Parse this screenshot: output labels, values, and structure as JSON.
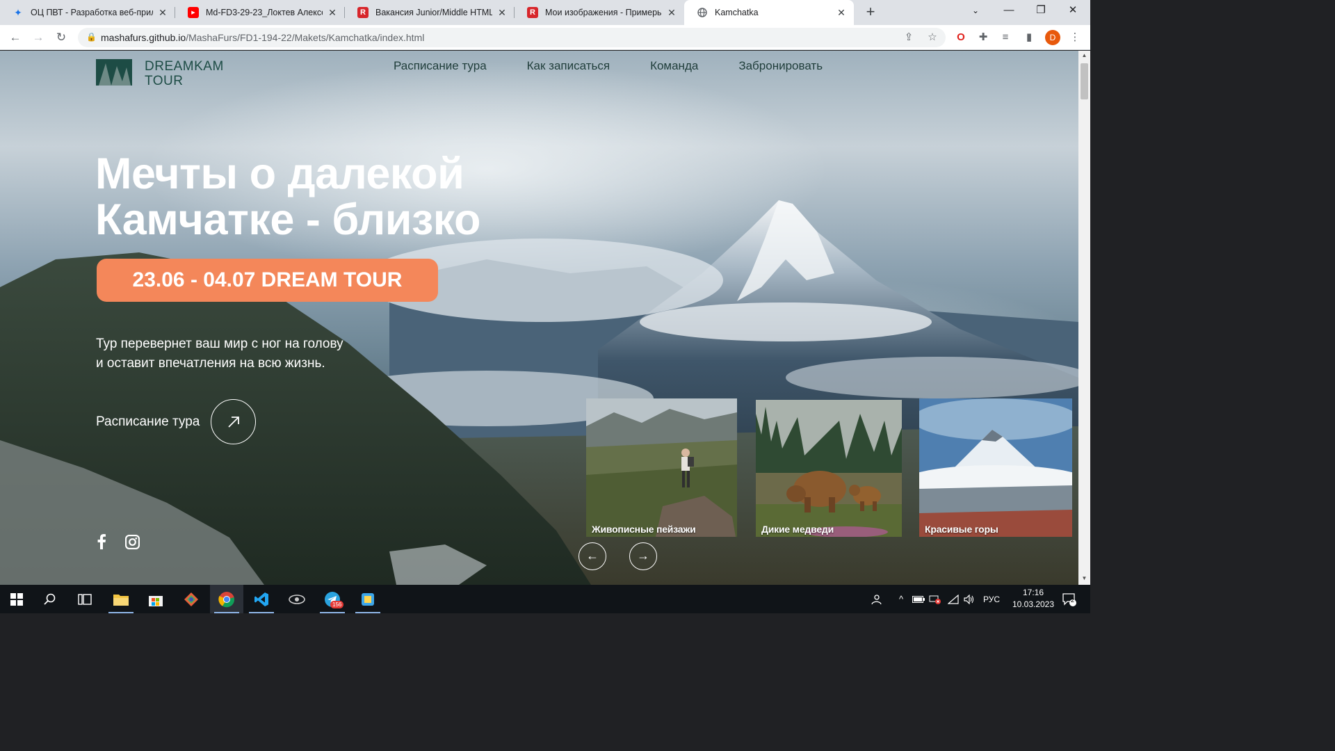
{
  "browser": {
    "tabs": [
      {
        "title": "ОЦ ПВТ - Разработка веб-прил",
        "favicon": "ic-pvt-icon"
      },
      {
        "title": "Md-FD3-29-23_Локтев Алексей",
        "favicon": "youtube-icon"
      },
      {
        "title": "Вакансия Junior/Middle HTML-в",
        "favicon": "r-logo-icon"
      },
      {
        "title": "Мои изображения - Примеры р",
        "favicon": "r-logo-icon"
      },
      {
        "title": "Kamchatka",
        "favicon": "globe-icon"
      }
    ],
    "url_host": "mashafurs.github.io",
    "url_path": "/MashaFurs/FD1-194-22/Makets/Kamchatka/index.html",
    "profile_initial": "D"
  },
  "page": {
    "logo": {
      "line1": "DREAMKAM",
      "line2": "TOUR"
    },
    "nav": [
      "Расписание тура",
      "Как записаться",
      "Команда",
      "Забронировать"
    ],
    "hero": {
      "title_line1": "Мечты о далекой",
      "title_line2": "Камчатке - близко",
      "badge": "23.06 - 04.07 DREAM TOUR",
      "desc_line1": "Тур перевернет ваш мир с ног на голову",
      "desc_line2": "и оставит впечатления на всю жизнь.",
      "schedule_link": "Расписание тура"
    },
    "cards": [
      {
        "caption": "Живописные пейзажи"
      },
      {
        "caption": "Дикие медведи"
      },
      {
        "caption": "Красивые горы"
      }
    ],
    "colors": {
      "accent": "#f4875a",
      "logo": "#1d4c45"
    }
  },
  "taskbar": {
    "language": "РУС",
    "time": "17:16",
    "date": "10.03.2023",
    "telegram_badge": "156",
    "notifications_count": "2"
  }
}
